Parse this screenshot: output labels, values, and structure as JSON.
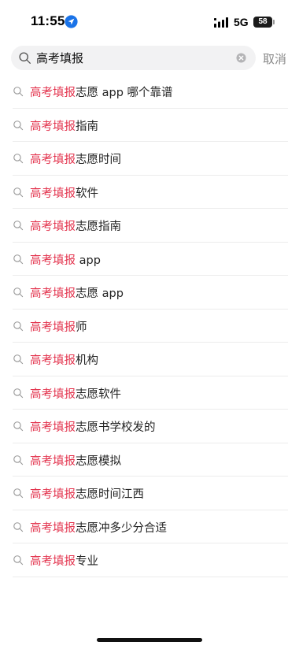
{
  "status_bar": {
    "time": "11:55",
    "network": "5G",
    "battery": "58"
  },
  "search": {
    "query": "高考填报",
    "cancel_label": "取消"
  },
  "suggestions": [
    {
      "highlight": "高考填报",
      "rest": "志愿 app 哪个靠谱"
    },
    {
      "highlight": "高考填报",
      "rest": "指南"
    },
    {
      "highlight": "高考填报",
      "rest": "志愿时间"
    },
    {
      "highlight": "高考填报",
      "rest": "软件"
    },
    {
      "highlight": "高考填报",
      "rest": "志愿指南"
    },
    {
      "highlight": "高考填报",
      "rest": " app"
    },
    {
      "highlight": "高考填报",
      "rest": "志愿 app"
    },
    {
      "highlight": "高考填报",
      "rest": "师"
    },
    {
      "highlight": "高考填报",
      "rest": "机构"
    },
    {
      "highlight": "高考填报",
      "rest": "志愿软件"
    },
    {
      "highlight": "高考填报",
      "rest": "志愿书学校发的"
    },
    {
      "highlight": "高考填报",
      "rest": "志愿模拟"
    },
    {
      "highlight": "高考填报",
      "rest": "志愿时间江西"
    },
    {
      "highlight": "高考填报",
      "rest": "志愿冲多少分合适"
    },
    {
      "highlight": "高考填报",
      "rest": "专业"
    }
  ],
  "colors": {
    "highlight": "#e3334d",
    "search_bg": "#f2f2f3",
    "cancel": "#8a8a8a"
  }
}
